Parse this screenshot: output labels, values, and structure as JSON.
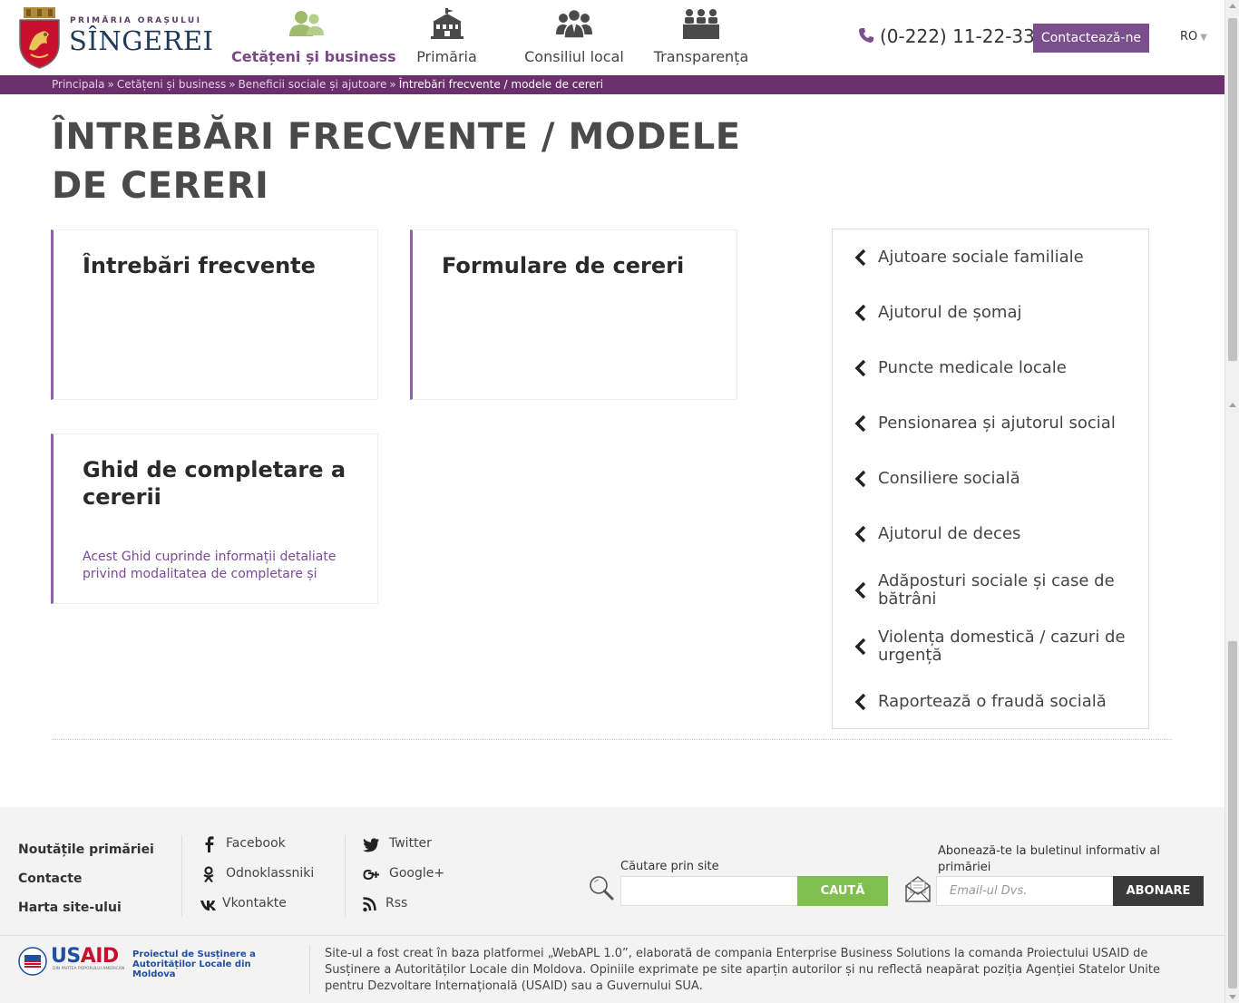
{
  "header": {
    "logo_top": "PRIMĂRIA ORAȘULUI",
    "logo_name": "SÎNGEREI",
    "nav": [
      {
        "label": "Cetățeni și business",
        "icon": "citizens-icon",
        "active": true
      },
      {
        "label": "Primăria",
        "icon": "city-hall-icon",
        "active": false
      },
      {
        "label": "Consiliul local",
        "icon": "council-icon",
        "active": false
      },
      {
        "label": "Transparența",
        "icon": "transparency-icon",
        "active": false
      }
    ],
    "phone": "(0-222) 11-22-33",
    "contact_label": "Contactează-ne",
    "language": "RO"
  },
  "breadcrumb": {
    "items": [
      "Principala",
      "Cetățeni și business",
      "Beneficii sociale și ajutoare"
    ],
    "separator": "»",
    "current": "Întrebări frecvente / modele de cereri"
  },
  "page": {
    "title": "ÎNTREBĂRI FRECVENTE / MODELE DE CERERI"
  },
  "cards": [
    {
      "title": "Întrebări frecvente",
      "description": ""
    },
    {
      "title": "Formulare de cereri",
      "description": ""
    },
    {
      "title": "Ghid de completare a cererii",
      "description": "Acest Ghid cuprinde informații detaliate privind modalitatea de completare și"
    }
  ],
  "sidebar": {
    "items": [
      "Ajutoare sociale familiale",
      "Ajutorul de șomaj",
      "Puncte medicale locale",
      "Pensionarea și ajutorul social",
      "Consiliere socială",
      "Ajutorul de deces",
      "Adăposturi sociale și case de bătrâni",
      "Violența domestică / cazuri de urgență",
      "Raportează o fraudă socială"
    ]
  },
  "footer": {
    "links": [
      "Noutățile primăriei",
      "Contacte",
      "Harta site-ului"
    ],
    "social_col1": [
      {
        "label": "Facebook",
        "icon": "facebook-icon"
      },
      {
        "label": "Odnoklassniki",
        "icon": "odnoklassniki-icon"
      },
      {
        "label": "Vkontakte",
        "icon": "vkontakte-icon"
      }
    ],
    "social_col2": [
      {
        "label": "Twitter",
        "icon": "twitter-icon"
      },
      {
        "label": "Google+",
        "icon": "google-plus-icon"
      },
      {
        "label": "Rss",
        "icon": "rss-icon"
      }
    ],
    "search": {
      "label": "Căutare prin site",
      "placeholder": "",
      "button": "CAUTĂ"
    },
    "newsletter": {
      "label": "Abonează-te la buletinul informativ al primăriei",
      "placeholder": "Email-ul Dvs.",
      "button": "ABONARE"
    },
    "usaid": {
      "logo": "USAID",
      "tagline": "DIN PARTEA POPORULUI AMERICAN",
      "project": "Proiectul de Susținere a Autorităților Locale din Moldova"
    },
    "credits": "Site-ul a fost creat în baza platformei „WebAPL 1.0”, elaborată de compania Enterprise Business Solutions la comanda Proiectului USAID de Susținere a Autorităților Locale din Moldova. Opiniile exprimate pe site aparțin autorilor și nu reflectă neapărat poziția Agenției Statelor Unite pentru Dezvoltare Internațională (USAID) sau a Guvernului SUA."
  },
  "colors": {
    "brand_purple": "#6c2f6d",
    "button_purple": "#7b4e8c",
    "card_accent": "#8a63a8",
    "search_green": "#7fbf4d",
    "nav_active_icon": "#9dbb6a"
  }
}
